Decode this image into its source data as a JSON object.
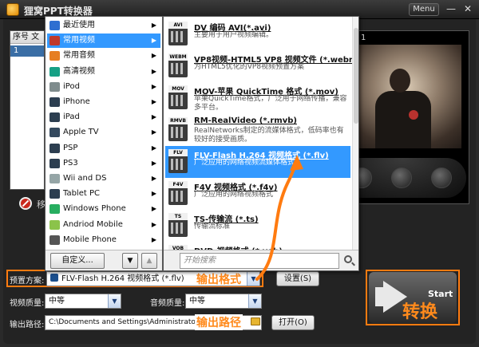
{
  "window": {
    "title": "狸窝PPT转换器",
    "menu_label": "Menu",
    "min_glyph": "—",
    "close_glyph": "✕"
  },
  "filelist": {
    "header": "序号  文",
    "row_index": "1"
  },
  "delete_row_text": "移",
  "preview": {
    "label": "1"
  },
  "left_menu": {
    "items": [
      {
        "label": "最近使用",
        "icon": "clock-icon",
        "color": "#2e6fd1",
        "submenu": true
      },
      {
        "label": "常用视频",
        "icon": "video-icon",
        "color": "#c0392b",
        "submenu": true,
        "selected": true
      },
      {
        "label": "常用音频",
        "icon": "music-icon",
        "color": "#e67e22",
        "submenu": true
      },
      {
        "label": "高清视频",
        "icon": "hd-icon",
        "color": "#16a085",
        "submenu": true
      },
      {
        "label": "iPod",
        "icon": "ipod-icon",
        "color": "#7f8c8d",
        "submenu": true
      },
      {
        "label": "iPhone",
        "icon": "iphone-icon",
        "color": "#2c3e50",
        "submenu": true
      },
      {
        "label": "iPad",
        "icon": "ipad-icon",
        "color": "#2c3e50",
        "submenu": true
      },
      {
        "label": "Apple TV",
        "icon": "apple-tv-icon",
        "color": "#34495e",
        "submenu": true
      },
      {
        "label": "PSP",
        "icon": "psp-icon",
        "color": "#2c3e50",
        "submenu": true
      },
      {
        "label": "PS3",
        "icon": "ps3-icon",
        "color": "#2c3e50",
        "submenu": true
      },
      {
        "label": "Wii and DS",
        "icon": "wii-icon",
        "color": "#95a5a6",
        "submenu": true
      },
      {
        "label": "Tablet PC",
        "icon": "tablet-icon",
        "color": "#2c3e50",
        "submenu": true
      },
      {
        "label": "Windows Phone",
        "icon": "windows-phone-icon",
        "color": "#27ae60",
        "submenu": true
      },
      {
        "label": "Andriod Mobile",
        "icon": "android-icon",
        "color": "#8bc34a",
        "submenu": true
      },
      {
        "label": "Mobile Phone",
        "icon": "mobile-phone-icon",
        "color": "#555555",
        "submenu": true
      }
    ],
    "custom_button": "自定义...",
    "down_glyph": "▼",
    "up_glyph": "▲"
  },
  "formats": {
    "items": [
      {
        "tag": "AVI",
        "title": "DV 编码 AVI(*.avi)",
        "desc": "主要用于用户视频编辑。"
      },
      {
        "tag": "WEBM",
        "title": "VP8视频-HTML5 VP8 视频文件 (*.webm)",
        "desc": "为HTML5优化的VP8视频预置方案"
      },
      {
        "tag": "MOV",
        "title": "MOV-苹果 QuickTime 格式 (*.mov)",
        "desc": "苹果QuickTime格式，广泛用于网络传播，兼容多平台。"
      },
      {
        "tag": "RMVB",
        "title": "RM-RealVideo (*.rmvb)",
        "desc": "RealNetworks制定的流媒体格式，低码率也有较好的接受画质。"
      },
      {
        "tag": "FLV",
        "title": "FLV-Flash H.264 视频格式 (*.flv)",
        "desc": "广泛应用的网络视频流媒体格式",
        "selected": true
      },
      {
        "tag": "F4V",
        "title": "F4V 视频格式 (*.f4v)",
        "desc": "广泛应用的网络视频格式"
      },
      {
        "tag": "TS",
        "title": "TS-传输流 (*.ts)",
        "desc": "传输流标准"
      },
      {
        "tag": "VOB",
        "title": "DVD-视频格式 (*.vob)",
        "desc": ""
      }
    ],
    "search_placeholder": "开始搜索"
  },
  "settings": {
    "preset_label": "预置方案:",
    "preset_value": "FLV-Flash H.264 视频格式 (*.flv)",
    "settings_button": "设置(S)",
    "video_quality_label": "视频质量:",
    "video_quality_value": "中等",
    "audio_quality_label": "音频质量:",
    "audio_quality_value": "中等",
    "output_label": "输出路径:",
    "output_value": "C:\\Documents and Settings\\Administrator\\桌面",
    "open_button": "打开(O)"
  },
  "annotations": {
    "format": "输出格式",
    "path": "输出路径",
    "convert": "转换"
  },
  "start": {
    "label": "Start"
  },
  "colors": {
    "accent": "#ff7b10",
    "selection": "#3399ff",
    "chrome": "#232323"
  }
}
